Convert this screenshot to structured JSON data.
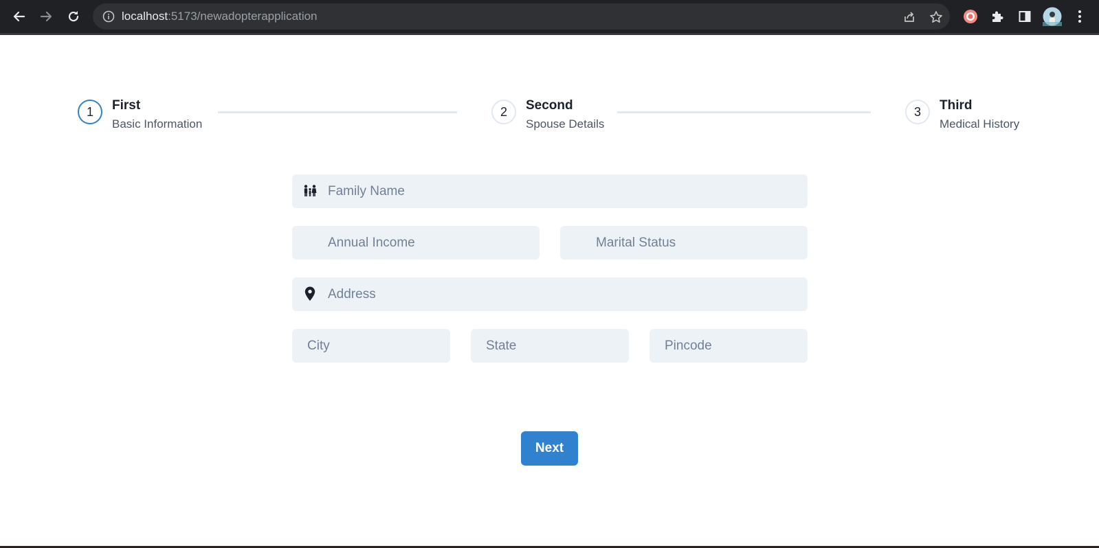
{
  "browser": {
    "url_host": "localhost",
    "url_path": ":5173/newadopterapplication",
    "icons": [
      "back-arrow-icon",
      "forward-arrow-icon",
      "reload-icon",
      "site-info-icon",
      "share-icon",
      "bookmark-star-icon",
      "extension-record-icon",
      "extensions-puzzle-icon",
      "side-panel-icon",
      "profile-avatar",
      "kebab-menu-icon"
    ]
  },
  "stepper": {
    "steps": [
      {
        "number": "1",
        "title": "First",
        "description": "Basic Information",
        "state": "active"
      },
      {
        "number": "2",
        "title": "Second",
        "description": "Spouse Details",
        "state": "inactive"
      },
      {
        "number": "3",
        "title": "Third",
        "description": "Medical History",
        "state": "inactive"
      }
    ]
  },
  "form": {
    "family_name": {
      "placeholder": "Family Name",
      "icon": "family-icon"
    },
    "annual_income": {
      "placeholder": "Annual Income"
    },
    "marital_status": {
      "placeholder": "Marital Status"
    },
    "address": {
      "placeholder": "Address",
      "icon": "location-pin-icon"
    },
    "city": {
      "placeholder": "City"
    },
    "state": {
      "placeholder": "State"
    },
    "pincode": {
      "placeholder": "Pincode"
    },
    "next_label": "Next"
  },
  "colors": {
    "accent": "#3182ce",
    "input_bg": "#edf2f7",
    "chrome_bg": "#202124"
  }
}
